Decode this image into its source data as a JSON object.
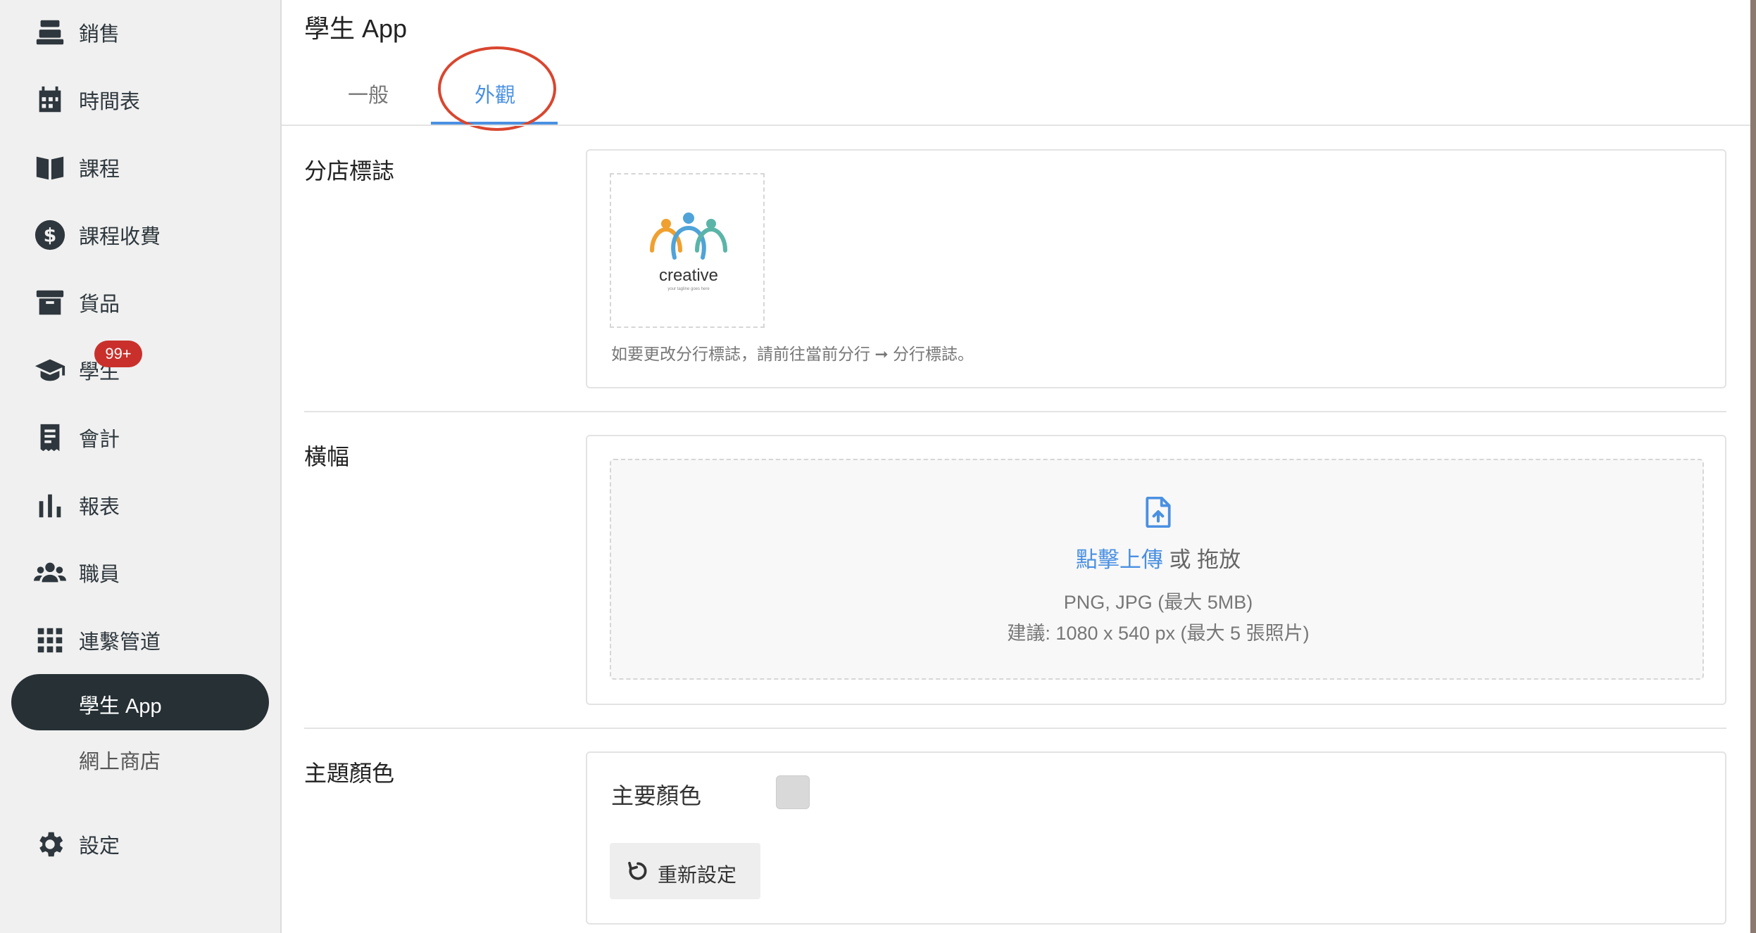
{
  "sidebar": {
    "items": [
      {
        "label": "銷售",
        "icon": "cash-register-icon"
      },
      {
        "label": "時間表",
        "icon": "calendar-icon"
      },
      {
        "label": "課程",
        "icon": "book-icon"
      },
      {
        "label": "課程收費",
        "icon": "dollar-icon"
      },
      {
        "label": "貨品",
        "icon": "archive-icon"
      },
      {
        "label": "學生",
        "icon": "graduation-cap-icon",
        "badge": "99+"
      },
      {
        "label": "會計",
        "icon": "receipt-icon"
      },
      {
        "label": "報表",
        "icon": "bar-chart-icon"
      },
      {
        "label": "職員",
        "icon": "users-icon"
      },
      {
        "label": "連繫管道",
        "icon": "grid-icon"
      }
    ],
    "sub_items": [
      {
        "label": "學生 App",
        "active": true
      },
      {
        "label": "網上商店",
        "active": false
      }
    ],
    "settings": {
      "label": "設定",
      "icon": "gear-icon"
    }
  },
  "main": {
    "title": "學生 App",
    "tabs": [
      {
        "label": "一般",
        "active": false
      },
      {
        "label": "外觀",
        "active": true
      }
    ],
    "logo_section": {
      "label": "分店標誌",
      "logo_text": "creative",
      "logo_tagline": "your tagline goes here",
      "hint": "如要更改分行標誌，請前往當前分行 ➞ 分行標誌。"
    },
    "banner_section": {
      "label": "橫幅",
      "upload_link": "點擊上傳",
      "upload_rest": " 或 拖放",
      "formats": "PNG, JPG (最大 5MB)",
      "suggestion": "建議: 1080 x 540 px (最大 5 張照片)"
    },
    "theme_section": {
      "label": "主題顏色",
      "primary_label": "主要顏色",
      "primary_color": "#d9d9d9",
      "reset_label": "重新設定"
    }
  },
  "colors": {
    "accent": "#4a90e2",
    "sidebar_active": "#263035",
    "badge": "#c9302c",
    "highlight": "#d9462f"
  }
}
